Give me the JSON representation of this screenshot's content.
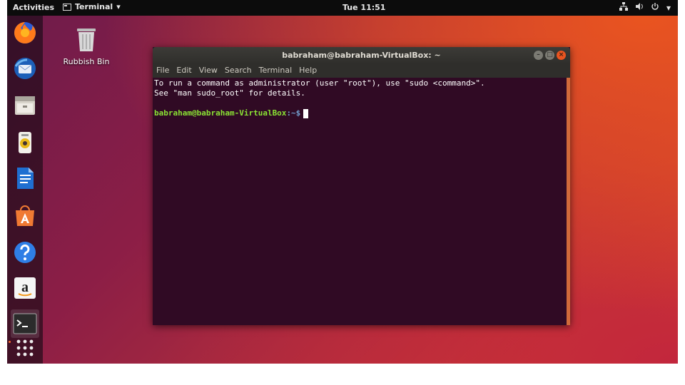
{
  "topbar": {
    "activities": "Activities",
    "app_name": "Terminal",
    "app_menu_arrow": "▾",
    "clock": "Tue 11:51",
    "tray": [
      "network-icon",
      "volume-icon",
      "power-icon"
    ],
    "tray_glyphs": {
      "network": "品",
      "volume": "🔊",
      "power": "⏻",
      "arrow": "▾"
    }
  },
  "dock": {
    "items": [
      "firefox-icon",
      "thunderbird-icon",
      "files-icon",
      "rhythmbox-icon",
      "libreoffice-writer-icon",
      "software-icon",
      "help-icon",
      "amazon-icon",
      "terminal-icon"
    ],
    "show_apps": "show-applications-icon"
  },
  "desktop": {
    "trash_label": "Rubbish Bin"
  },
  "window": {
    "title": "babraham@babraham-VirtualBox: ~",
    "menu": [
      "File",
      "Edit",
      "View",
      "Search",
      "Terminal",
      "Help"
    ],
    "lines": [
      "To run a command as administrator (user \"root\"), use \"sudo <command>\".",
      "See \"man sudo_root\" for details."
    ],
    "prompt_user": "babraham@babraham-VirtualBox",
    "prompt_path": ":~$"
  },
  "colors": {
    "accent": "#e95420",
    "terminal_bg": "#300a24",
    "prompt_green": "#8ae234"
  }
}
